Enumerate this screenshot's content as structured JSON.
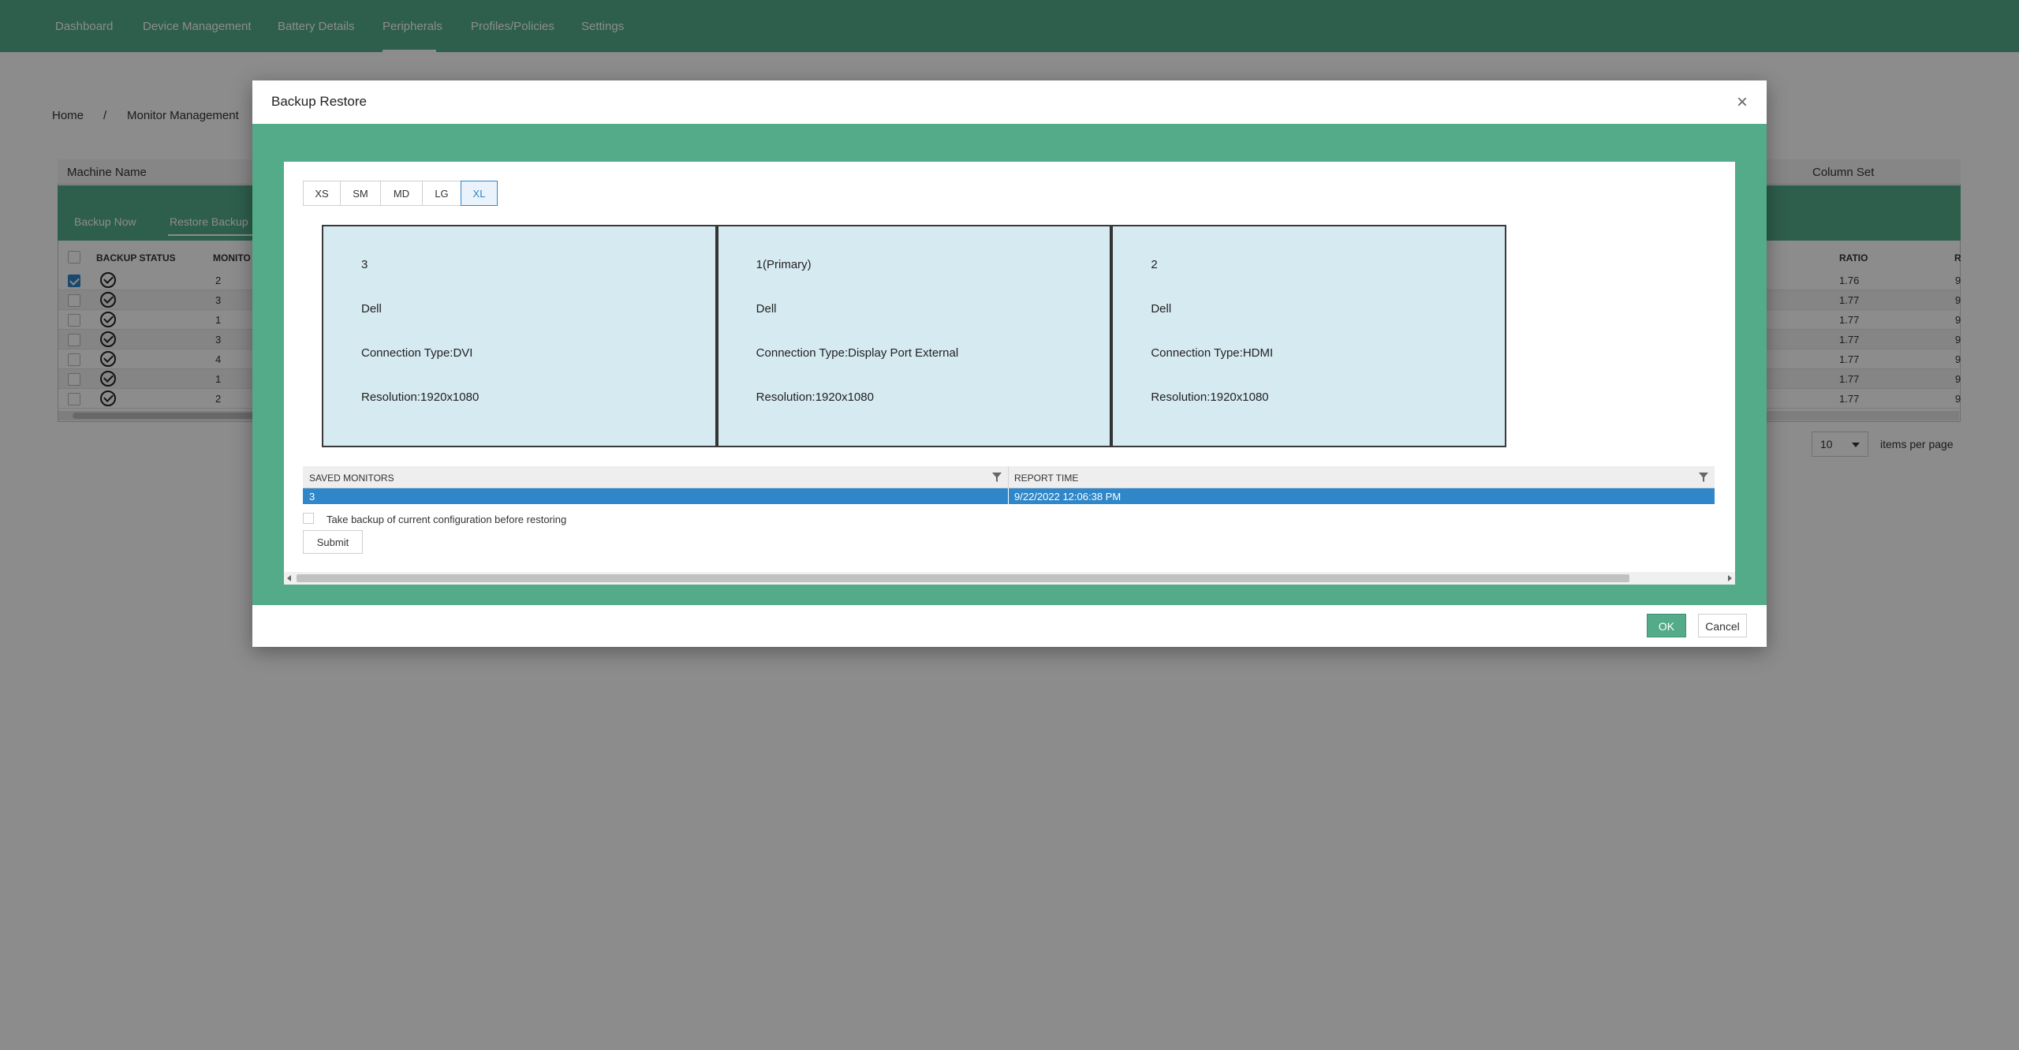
{
  "nav": {
    "items": [
      "Dashboard",
      "Device Management",
      "Battery Details",
      "Peripherals",
      "Profiles/Policies",
      "Settings"
    ],
    "active": "Peripherals"
  },
  "breadcrumb": {
    "home": "Home",
    "separator": "/",
    "current": "Monitor Management"
  },
  "grid": {
    "machine_name_label": "Machine Name",
    "column_set_label": "Column Set",
    "toolbar": {
      "backup_now": "Backup Now",
      "restore_backup": "Restore Backup"
    },
    "columns": {
      "backup_status": "BACKUP STATUS",
      "monitors": "MONITO",
      "ratio": "RATIO",
      "truncated": "R"
    },
    "rows": [
      {
        "checked": true,
        "monitors": "2",
        "ratio": "1.76",
        "trunc": "9"
      },
      {
        "checked": false,
        "monitors": "3",
        "ratio": "1.77",
        "trunc": "9"
      },
      {
        "checked": false,
        "monitors": "1",
        "ratio": "1.77",
        "trunc": "9"
      },
      {
        "checked": false,
        "monitors": "3",
        "ratio": "1.77",
        "trunc": "9"
      },
      {
        "checked": false,
        "monitors": "4",
        "ratio": "1.77",
        "trunc": "9"
      },
      {
        "checked": false,
        "monitors": "1",
        "ratio": "1.77",
        "trunc": "9"
      },
      {
        "checked": false,
        "monitors": "2",
        "ratio": "1.77",
        "trunc": "9"
      }
    ],
    "pager": {
      "page_size": "10",
      "items_per_page": "items per page"
    }
  },
  "modal": {
    "title": "Backup Restore",
    "close_glyph": "×",
    "size_buttons": [
      "XS",
      "SM",
      "MD",
      "LG",
      "XL"
    ],
    "active_size": "XL",
    "monitors": [
      {
        "id": "3",
        "vendor": "Dell",
        "connection": "Connection Type:DVI",
        "resolution": "Resolution:1920x1080"
      },
      {
        "id": "1(Primary)",
        "vendor": "Dell",
        "connection": "Connection Type:Display Port External",
        "resolution": "Resolution:1920x1080"
      },
      {
        "id": "2",
        "vendor": "Dell",
        "connection": "Connection Type:HDMI",
        "resolution": "Resolution:1920x1080"
      }
    ],
    "saved_table": {
      "headers": {
        "saved_monitors": "SAVED MONITORS",
        "report_time": "REPORT TIME"
      },
      "rows": [
        {
          "saved_monitors": "3",
          "report_time": "9/22/2022 12:06:38 PM",
          "selected": true
        }
      ]
    },
    "backup_checkbox": {
      "label": "Take backup of current configuration before restoring",
      "checked": false
    },
    "submit_label": "Submit",
    "ok_label": "OK",
    "cancel_label": "Cancel"
  },
  "colors": {
    "brand_green": "#54ab8a",
    "selection_blue": "#2f86c8",
    "monitor_fill": "#d6eaf1",
    "overlay": "rgba(0,0,0,0.45)"
  }
}
